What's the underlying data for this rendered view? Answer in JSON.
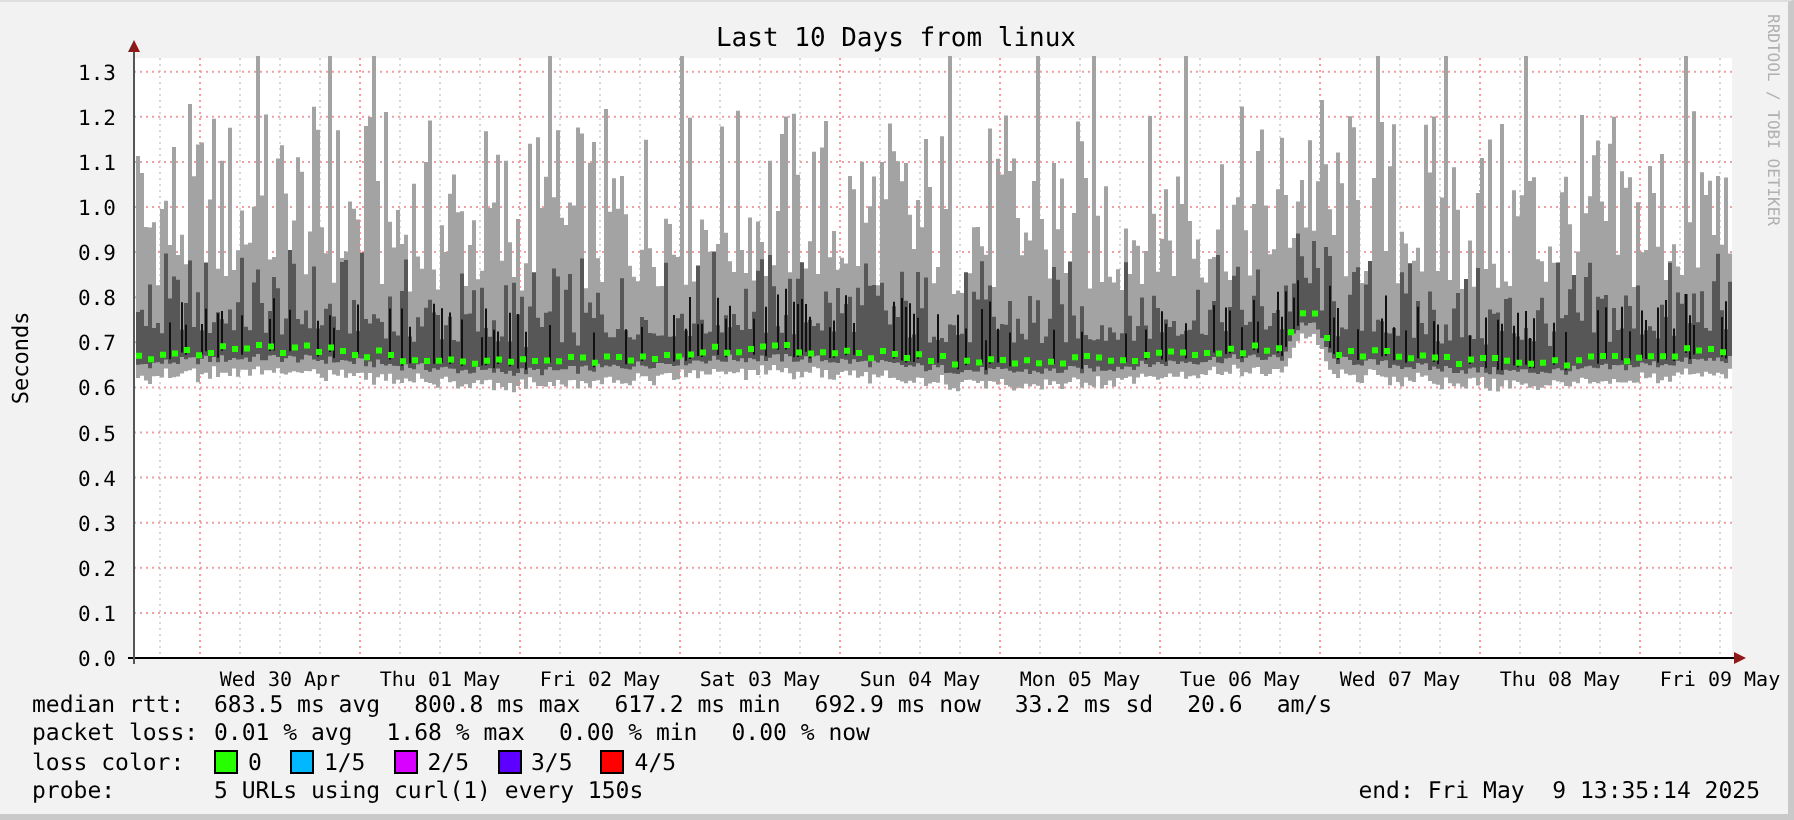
{
  "graph": {
    "title": "Last 10 Days from linux",
    "y_label": "Seconds",
    "credit": "RRDTOOL / TOBI OETIKER",
    "y_ticks": [
      "1.3",
      "1.2",
      "1.1",
      "1.0",
      "0.9",
      "0.8",
      "0.7",
      "0.6",
      "0.5",
      "0.4",
      "0.3",
      "0.2",
      "0.1",
      "0.0"
    ],
    "x_labels": [
      "Wed 30 Apr",
      "Thu 01 May",
      "Fri 02 May",
      "Sat 03 May",
      "Sun 04 May",
      "Mon 05 May",
      "Tue 06 May",
      "Wed 07 May",
      "Thu 08 May",
      "Fri 09 May"
    ]
  },
  "legend": {
    "median_rtt": {
      "label": "median rtt:",
      "values": [
        "683.5 ms avg",
        "800.8 ms max",
        "617.2 ms min",
        "692.9 ms now",
        "33.2 ms sd",
        "20.6",
        "am/s"
      ]
    },
    "packet_loss": {
      "label": "packet loss:",
      "values": [
        "0.01 % avg",
        "1.68 % max",
        "0.00 % min",
        "0.00 % now"
      ]
    },
    "loss_color": {
      "label": "loss color:",
      "items": [
        {
          "label": "0",
          "color": "#26ff00"
        },
        {
          "label": "1/5",
          "color": "#00b8ff"
        },
        {
          "label": "2/5",
          "color": "#d800ff"
        },
        {
          "label": "3/5",
          "color": "#5e00ff"
        },
        {
          "label": "4/5",
          "color": "#ff0000"
        }
      ]
    },
    "probe": {
      "label": "probe:",
      "text": "5 URLs using curl(1) every 150s"
    },
    "end": "end: Fri May  9 13:35:14 2025"
  }
}
